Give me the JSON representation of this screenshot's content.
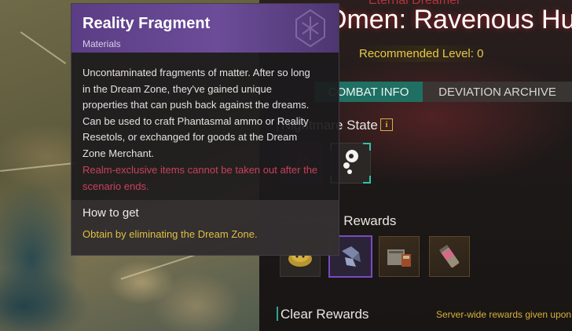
{
  "boss": {
    "subtitle": "Eternal Dreamer",
    "title": "Omen: Ravenous Hu",
    "recommended_level": "Recommended Level: 0"
  },
  "tabs": [
    {
      "label": "COMBAT INFO",
      "active": true
    },
    {
      "label": "DEVIATION ARCHIVE",
      "active": false
    }
  ],
  "sections": {
    "nightmare_state": "Nightmare State",
    "challenge_rewards": "Challenge Rewards",
    "clear_rewards": "Clear Rewards",
    "server_note": "Server-wide rewards given upon"
  },
  "nightmare_state_slots": [
    {
      "icon": "claw-mark-icon"
    },
    {
      "icon": "paint-drip-icon"
    }
  ],
  "challenge_reward_slots": [
    {
      "icon": "gold-pile-icon",
      "selected": false
    },
    {
      "icon": "crystal-fragment-icon",
      "selected": true
    },
    {
      "icon": "supply-crate-icon",
      "selected": false
    },
    {
      "icon": "ammo-canister-icon",
      "selected": false
    }
  ],
  "tooltip": {
    "title": "Reality Fragment",
    "category": "Materials",
    "description": "Uncontaminated fragments of matter. After so long in the Dream Zone, they've gained unique properties that can push back against the dreams. Can be used to craft Phantasmal ammo or Reality Resetols, or exchanged for goods at the Dream Zone Merchant.",
    "warning": "Realm-exclusive items cannot be taken out after the scenario ends.",
    "how_to_get_label": "How to get",
    "how_to_get_text": "Obtain by eliminating the Dream Zone."
  },
  "colors": {
    "accent_teal": "#1f6f63",
    "tooltip_purple": "#5b3d85",
    "warning_red": "#c9405a",
    "gold": "#e0bf45",
    "boss_red": "#b8323a"
  }
}
